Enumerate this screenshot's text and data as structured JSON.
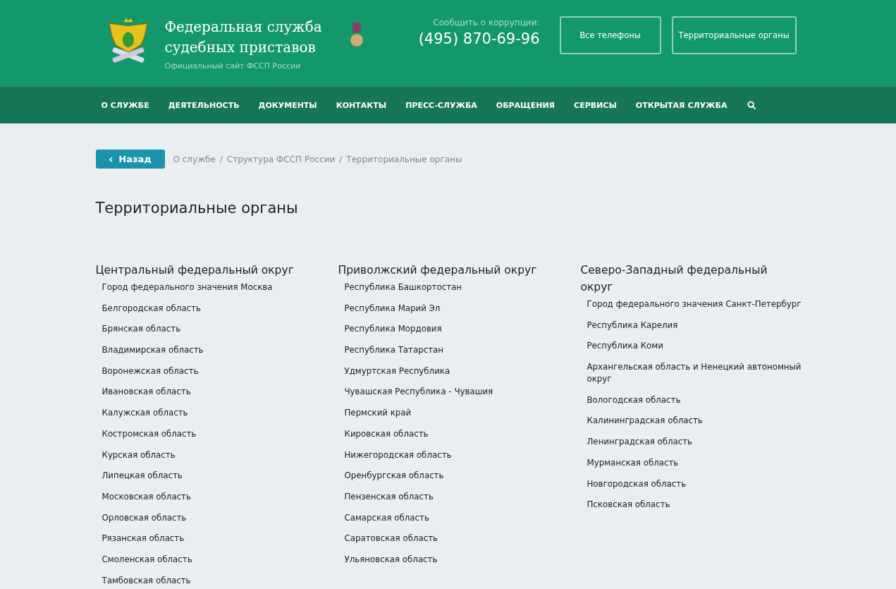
{
  "header": {
    "title_line_1": "Федеральная служба",
    "title_line_2": "судебных приставов",
    "subtitle": "Официальный сайт ФССП России",
    "hotline_label": "Сообщить о коррупции:",
    "hotline_phone": "(495) 870-69-96",
    "buttons": [
      "Все телефоны",
      "Территориальные органы"
    ]
  },
  "nav": [
    "О СЛУЖБЕ",
    "ДЕЯТЕЛЬНОСТЬ",
    "ДОКУМЕНТЫ",
    "КОНТАКТЫ",
    "ПРЕСС-СЛУЖБА",
    "ОБРАЩЕНИЯ",
    "СЕРВИСЫ",
    "ОТКРЫТАЯ СЛУЖБА"
  ],
  "back_button": {
    "icon": "‹",
    "label": "Назад"
  },
  "breadcrumbs": [
    {
      "label": "О службе",
      "separator": "/"
    },
    {
      "label": "Структура ФССП России",
      "separator": "/"
    },
    {
      "label": "Территориальные органы"
    }
  ],
  "page_title": "Территориальные органы",
  "districts": [
    {
      "name": "Центральный федеральный округ",
      "items": [
        "Город федерального значения Москва",
        "Белгородская область",
        "Брянская область",
        "Владимирская область",
        "Воронежская область",
        "Ивановская область",
        "Калужская область",
        "Костромская область",
        "Курская область",
        "Липецкая область",
        "Московская область",
        "Орловская область",
        "Рязанская область",
        "Смоленская область",
        "Тамбовская область"
      ]
    },
    {
      "name": "Приволжский федеральный округ",
      "items": [
        "Республика Башкортостан",
        "Республика Марий Эл",
        "Республика Мордовия",
        "Республика Татарстан",
        "Удмуртская Республика",
        "Чувашская Республика - Чувашия",
        "Пермский край",
        "Кировская область",
        "Нижегородская область",
        "Оренбургская область",
        "Пензенская область",
        "Самарская область",
        "Саратовская область",
        "Ульяновская область"
      ]
    },
    {
      "name": "Северо-Западный федеральный округ",
      "items": [
        "Город федерального значения Санкт-Петербург",
        "Республика Карелия",
        "Республика Коми",
        "Архангельская область и Ненецкий автономный округ",
        "Вологодская область",
        "Калининградская область",
        "Ленинградская область",
        "Мурманская область",
        "Новгородская область",
        "Псковская область"
      ]
    }
  ]
}
